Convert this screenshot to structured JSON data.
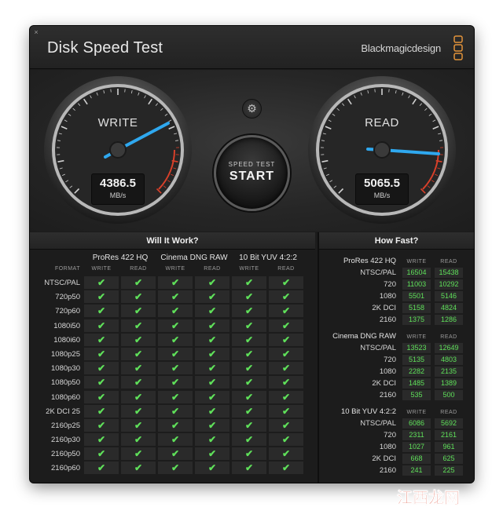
{
  "window": {
    "title": "Disk Speed Test",
    "brand": "Blackmagicdesign",
    "close_glyph": "×"
  },
  "gauges": {
    "write": {
      "label": "WRITE",
      "value": "4386.5",
      "unit": "MB/s"
    },
    "read": {
      "label": "READ",
      "value": "5065.5",
      "unit": "MB/s"
    }
  },
  "start_button": {
    "small": "SPEED TEST",
    "big": "START"
  },
  "settings_glyph": "⚙",
  "will_it_work": {
    "title": "Will It Work?",
    "format_header": "FORMAT",
    "codecs": [
      "ProRes 422 HQ",
      "Cinema DNG RAW",
      "10 Bit YUV 4:2:2"
    ],
    "write_label": "WRITE",
    "read_label": "READ",
    "check_glyph": "✔",
    "formats": [
      "NTSC/PAL",
      "720p50",
      "720p60",
      "1080i50",
      "1080i60",
      "1080p25",
      "1080p30",
      "1080p50",
      "1080p60",
      "2K DCI 25",
      "2160p25",
      "2160p30",
      "2160p50",
      "2160p60"
    ]
  },
  "how_fast": {
    "title": "How Fast?",
    "write_label": "WRITE",
    "read_label": "READ",
    "sections": [
      {
        "codec": "ProRes 422 HQ",
        "rows": [
          {
            "label": "NTSC/PAL",
            "write": "16504",
            "read": "15438"
          },
          {
            "label": "720",
            "write": "11003",
            "read": "10292"
          },
          {
            "label": "1080",
            "write": "5501",
            "read": "5146"
          },
          {
            "label": "2K DCI",
            "write": "5158",
            "read": "4824"
          },
          {
            "label": "2160",
            "write": "1375",
            "read": "1286"
          }
        ]
      },
      {
        "codec": "Cinema DNG RAW",
        "rows": [
          {
            "label": "NTSC/PAL",
            "write": "13523",
            "read": "12649"
          },
          {
            "label": "720",
            "write": "5135",
            "read": "4803"
          },
          {
            "label": "1080",
            "write": "2282",
            "read": "2135"
          },
          {
            "label": "2K DCI",
            "write": "1485",
            "read": "1389"
          },
          {
            "label": "2160",
            "write": "535",
            "read": "500"
          }
        ]
      },
      {
        "codec": "10 Bit YUV 4:2:2",
        "rows": [
          {
            "label": "NTSC/PAL",
            "write": "6086",
            "read": "5692"
          },
          {
            "label": "720",
            "write": "2311",
            "read": "2161"
          },
          {
            "label": "1080",
            "write": "1027",
            "read": "961"
          },
          {
            "label": "2K DCI",
            "write": "668",
            "read": "625"
          },
          {
            "label": "2160",
            "write": "241",
            "read": "225"
          }
        ]
      }
    ]
  },
  "watermark": "江西龙网",
  "colors": {
    "accent_needle": "#2fa8ef",
    "ok_green": "#5fe05a",
    "redline": "#d8402a"
  }
}
